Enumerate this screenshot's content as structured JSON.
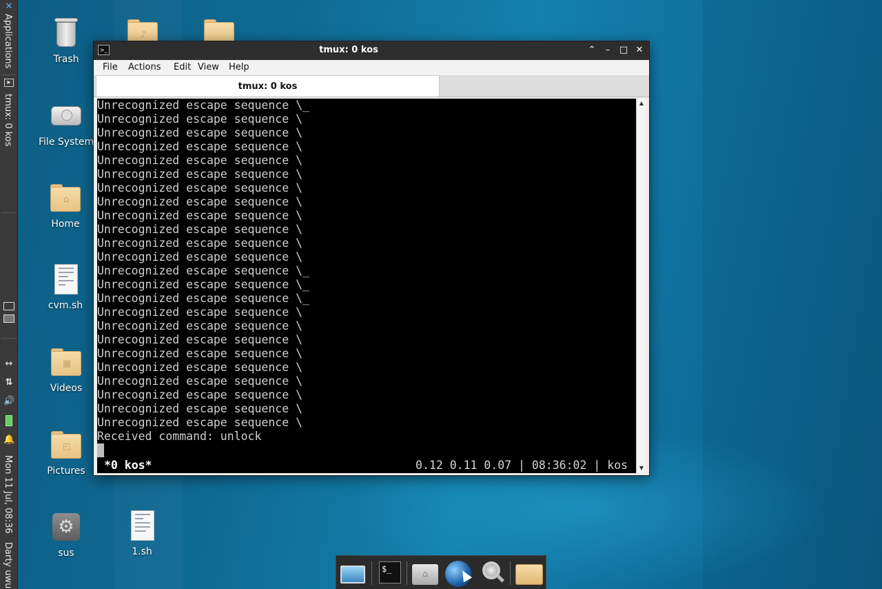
{
  "side_panel": {
    "applications_label": "Applications",
    "task_label": "tmux: 0 kos",
    "clock": "Mon 11 Jul, 08:36",
    "user": "Darty uwu"
  },
  "desktop_icons": {
    "trash": "Trash",
    "file_system": "File System",
    "home": "Home",
    "cvm": "cvm.sh",
    "videos": "Videos",
    "pictures": "Pictures",
    "sus": "sus",
    "one_sh": "1.sh"
  },
  "window": {
    "title": "tmux: 0 kos",
    "menu": [
      "File",
      "Actions",
      "Edit",
      "View",
      "Help"
    ],
    "tab_label": "tmux: 0 kos"
  },
  "terminal": {
    "lines": [
      "Unrecognized escape sequence \\_",
      "Unrecognized escape sequence \\",
      "Unrecognized escape sequence \\",
      "Unrecognized escape sequence \\",
      "Unrecognized escape sequence \\",
      "Unrecognized escape sequence \\",
      "Unrecognized escape sequence \\",
      "Unrecognized escape sequence \\",
      "Unrecognized escape sequence \\",
      "Unrecognized escape sequence \\",
      "Unrecognized escape sequence \\",
      "Unrecognized escape sequence \\",
      "Unrecognized escape sequence \\_",
      "Unrecognized escape sequence \\_",
      "Unrecognized escape sequence \\_",
      "Unrecognized escape sequence \\",
      "Unrecognized escape sequence \\",
      "Unrecognized escape sequence \\",
      "Unrecognized escape sequence \\",
      "Unrecognized escape sequence \\",
      "Unrecognized escape sequence \\",
      "Unrecognized escape sequence \\",
      "Unrecognized escape sequence \\",
      "Unrecognized escape sequence \\",
      "Received command: unlock"
    ],
    "status_left": "*0 kos*",
    "status_right": "0.12 0.11 0.07 | 08:36:02 | kos"
  },
  "dock": {
    "items": [
      "desktop-icon",
      "terminal-icon",
      "home-folder-icon",
      "web-browser-icon",
      "search-icon",
      "folder-icon"
    ],
    "terminal_glyph": "$_"
  }
}
